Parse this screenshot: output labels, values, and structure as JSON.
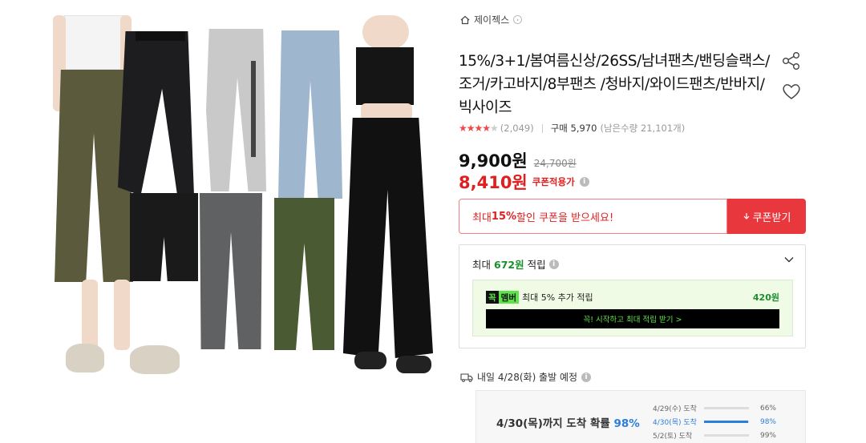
{
  "brand": {
    "name": "제이젝스"
  },
  "product": {
    "title": "15%/3+1/봄여름신상/26SS/남녀팬츠/밴딩슬랙스/조거/카고바지/8부팬츠 /청바지/와이드팬츠/반바지/빅사이즈",
    "rating": {
      "stars": 4.5,
      "count": "(2,049)"
    },
    "purchase": {
      "label": "구매 5,970",
      "stock": "(남은수량 21,101개)"
    }
  },
  "price": {
    "current": "9,900원",
    "original": "24,700원",
    "coupon_price": "8,410원",
    "coupon_label": "쿠폰적용가"
  },
  "coupon": {
    "prefix": "최대 ",
    "percent": "15%",
    "suffix": " 할인 쿠폰을 받으세요!",
    "button_label": "쿠폰받기"
  },
  "points": {
    "head_prefix": "최대 ",
    "amount": "672원",
    "head_suffix": " 적립",
    "member_badge_1": "꼭",
    "member_badge_2": "멤버",
    "member_text": "최대 5% 추가 적립",
    "member_amount": "420원",
    "member_cta": "꼭! 시작하고 최대 적립 받기 >"
  },
  "shipping": {
    "text": "내일 4/28(화) 출발 예정",
    "prob_prefix": "4/30(목)까지 도착 확률 ",
    "prob_pct": "98%",
    "lines": [
      {
        "date": "4/29(수) 도착",
        "pct": "66%",
        "value": 0.66,
        "active": false
      },
      {
        "date": "4/30(목) 도착",
        "pct": "98%",
        "value": 0.98,
        "active": true
      },
      {
        "date": "5/2(토) 도착",
        "pct": "99%",
        "value": 0.99,
        "active": false
      }
    ]
  },
  "colors": {
    "accent_red": "#e02020",
    "points_green": "#1a8f2e",
    "member_green": "#5fe34b",
    "prob_blue": "#2b7fd8"
  }
}
